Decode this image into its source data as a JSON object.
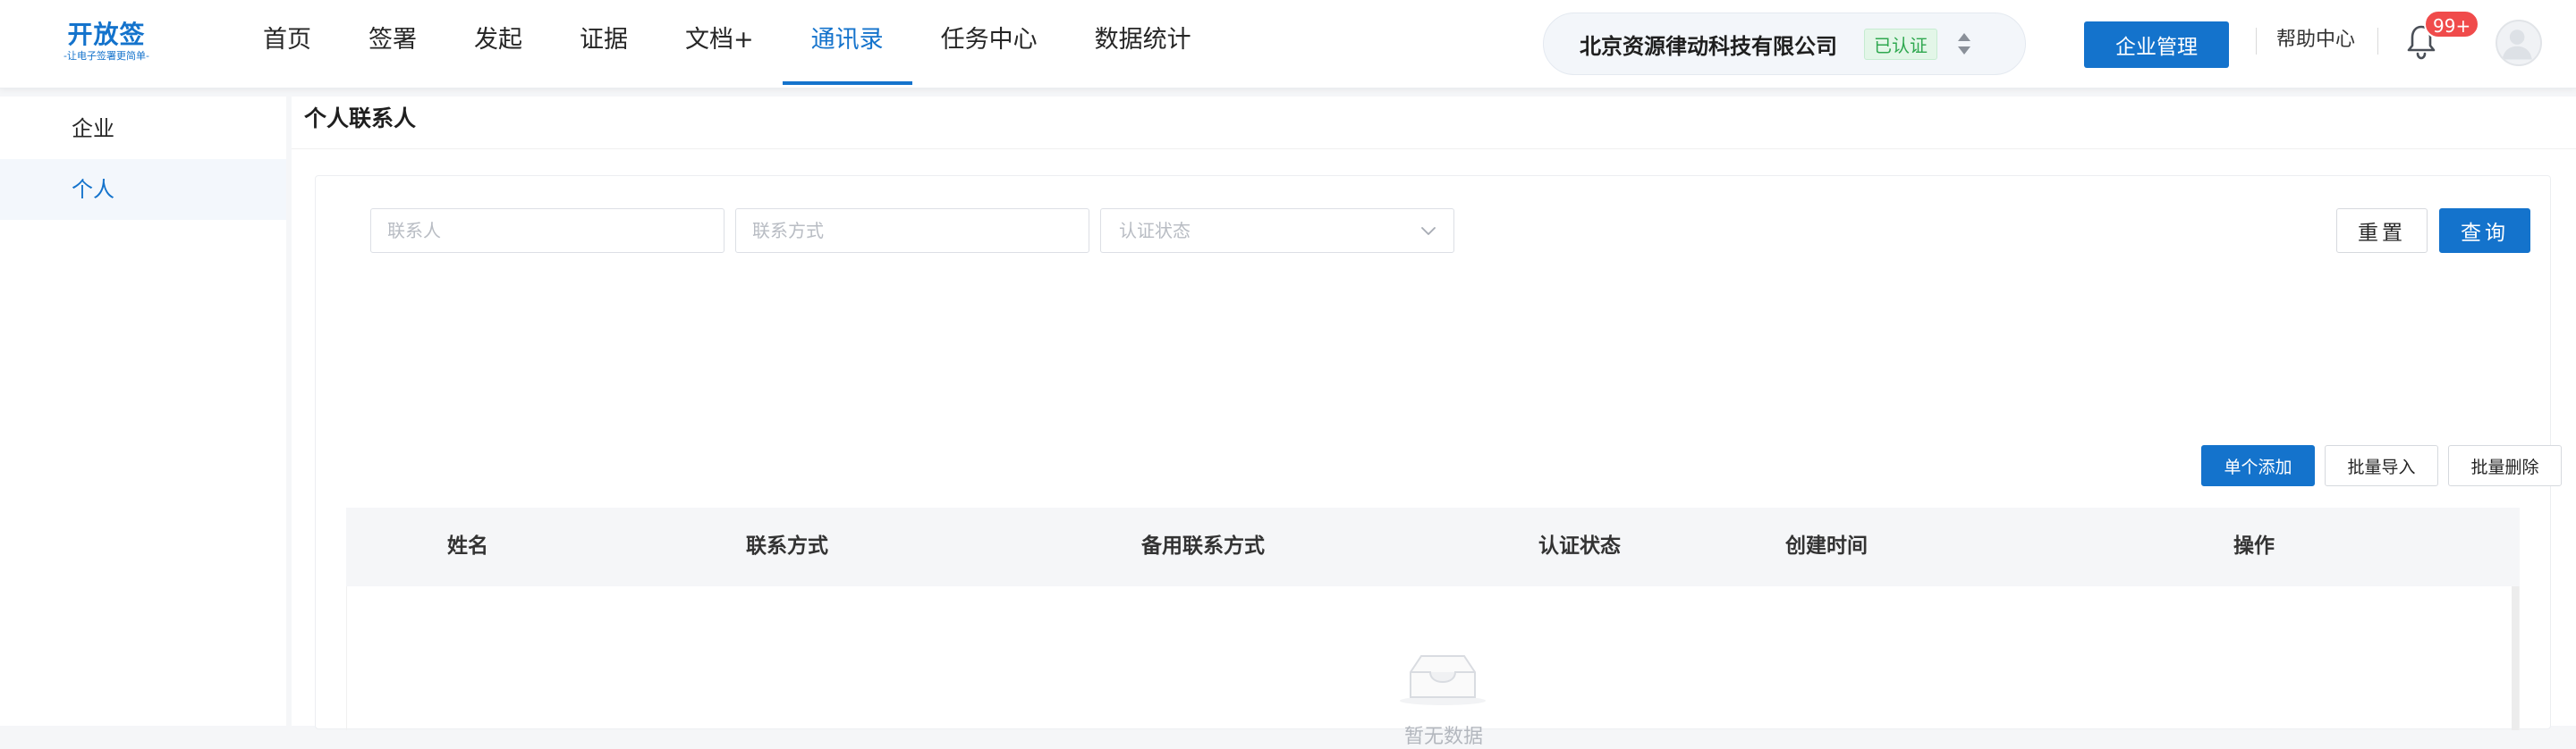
{
  "logo": {
    "title": "开放签",
    "subtitle": "-让电子签署更简单-"
  },
  "nav": {
    "items": [
      {
        "label": "首页"
      },
      {
        "label": "签署"
      },
      {
        "label": "发起"
      },
      {
        "label": "证据"
      },
      {
        "label": "文档+"
      },
      {
        "label": "通讯录",
        "active": true
      },
      {
        "label": "任务中心"
      },
      {
        "label": "数据统计"
      }
    ]
  },
  "company": {
    "name": "北京资源律动科技有限公司",
    "badge": "已认证"
  },
  "header": {
    "enterprise_button": "企业管理",
    "help": "帮助中心",
    "notifications_badge": "99+"
  },
  "sidebar": {
    "items": [
      {
        "label": "企业"
      },
      {
        "label": "个人",
        "active": true
      }
    ]
  },
  "page": {
    "title": "个人联系人"
  },
  "filters": {
    "contact_placeholder": "联系人",
    "method_placeholder": "联系方式",
    "status_placeholder": "认证状态",
    "reset": "重置",
    "query": "查询"
  },
  "actions": {
    "add_single": "单个添加",
    "batch_import": "批量导入",
    "batch_delete": "批量删除"
  },
  "table": {
    "columns": [
      "姓名",
      "联系方式",
      "备用联系方式",
      "认证状态",
      "创建时间",
      "操作"
    ],
    "rows": [],
    "empty_text": "暂无数据"
  },
  "colors": {
    "primary": "#1473cc",
    "verified": "#2fa84f",
    "badge": "#f04b4b"
  }
}
